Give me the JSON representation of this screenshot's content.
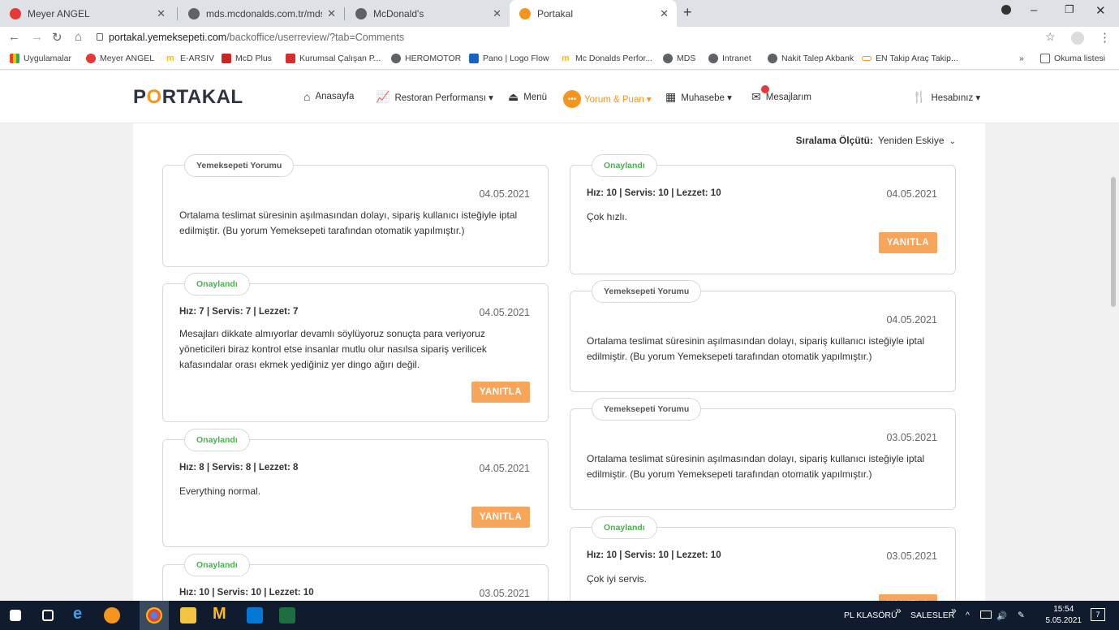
{
  "browser": {
    "tabs": [
      {
        "title": "Meyer ANGEL",
        "favicon": "meyer-icon",
        "active": false
      },
      {
        "title": "mds.mcdonalds.com.tr/mds/(S(c",
        "favicon": "globe-icon",
        "active": false
      },
      {
        "title": "McDonald's",
        "favicon": "globe-icon",
        "active": false
      },
      {
        "title": "Portakal",
        "favicon": "orange-icon",
        "active": true
      }
    ],
    "new_tab": "+",
    "url_host": "portakal.yemeksepeti.com",
    "url_path": "/backoffice/userreview/?tab=Comments",
    "bookmarks": [
      {
        "label": "Uygulamalar",
        "icon": "apps-icon"
      },
      {
        "label": "Meyer ANGEL",
        "icon": "meyer-icon"
      },
      {
        "label": "E-ARSIV",
        "icon": "mcdonalds-icon"
      },
      {
        "label": "McD Plus",
        "icon": "mcdonalds-icon"
      },
      {
        "label": "Kurumsal Çalışan P...",
        "icon": "u-icon"
      },
      {
        "label": "HEROMOTOR",
        "icon": "globe-icon"
      },
      {
        "label": "Pano | Logo Flow",
        "icon": "logo-icon"
      },
      {
        "label": "Mc Donalds Perfor...",
        "icon": "mcdonalds-icon"
      },
      {
        "label": "MDS",
        "icon": "globe-icon"
      },
      {
        "label": "Intranet",
        "icon": "globe-icon"
      },
      {
        "label": "Nakit Talep Akbank",
        "icon": "globe-icon"
      },
      {
        "label": "EN Takip Araç Takip...",
        "icon": "en-icon"
      }
    ],
    "bookmarks_more": "»",
    "reading_list": "Okuma listesi"
  },
  "site": {
    "logo": {
      "before": "P",
      "highlight": "O",
      "after": "RTAKAL"
    },
    "nav": [
      {
        "label": "Anasayfa",
        "icon": "home-icon"
      },
      {
        "label": "Restoran Performansı ▾",
        "icon": "chart-icon"
      },
      {
        "label": "Menü",
        "icon": "cloche-icon"
      },
      {
        "label": "Yorum & Puan ▾",
        "icon": "comment-icon"
      },
      {
        "label": "Muhasebe ▾",
        "icon": "grid-icon"
      },
      {
        "label": "Mesajlarım",
        "icon": "mail-icon"
      },
      {
        "label": "Hesabınız ▾",
        "icon": "fork-knife-icon"
      }
    ]
  },
  "sort": {
    "label": "Sıralama Ölçütü:",
    "value": "Yeniden Eskiye"
  },
  "reply_label": "YANITLA",
  "reviews_left": [
    {
      "status": "Yemeksepeti Yorumu",
      "scores": "",
      "date": "04.05.2021",
      "text": "Ortalama teslimat süresinin aşılmasından dolayı, sipariş kullanıcı isteğiyle iptal edilmiştir. (Bu yorum Yemeksepeti tarafından otomatik yapılmıştır.)"
    },
    {
      "status": "Onaylandı",
      "scores": "Hız: 7 | Servis: 7 | Lezzet: 7",
      "date": "04.05.2021",
      "text": "Mesajları dikkate almıyorlar devamlı söylüyoruz sonuçta para veriyoruz yöneticileri biraz kontrol etse insanlar mutlu olur nasılsa sipariş verilicek kafasındalar orası ekmek yediğiniz yer dingo ağırı değil."
    },
    {
      "status": "Onaylandı",
      "scores": "Hız: 8 | Servis: 8 | Lezzet: 8",
      "date": "04.05.2021",
      "text": "Everything normal."
    },
    {
      "status": "Onaylandı",
      "scores": "Hız: 10 | Servis: 10 | Lezzet: 10",
      "date": "03.05.2021",
      "text": ""
    }
  ],
  "reviews_right": [
    {
      "status": "Onaylandı",
      "scores": "Hız: 10 | Servis: 10 | Lezzet: 10",
      "date": "04.05.2021",
      "text": "Çok hızlı."
    },
    {
      "status": "Yemeksepeti Yorumu",
      "scores": "",
      "date": "04.05.2021",
      "text": "Ortalama teslimat süresinin aşılmasından dolayı, sipariş kullanıcı isteğiyle iptal edilmiştir. (Bu yorum Yemeksepeti tarafından otomatik yapılmıştır.)"
    },
    {
      "status": "Yemeksepeti Yorumu",
      "scores": "",
      "date": "03.05.2021",
      "text": "Ortalama teslimat süresinin aşılmasından dolayı, sipariş kullanıcı isteğiyle iptal edilmiştir. (Bu yorum Yemeksepeti tarafından otomatik yapılmıştır.)"
    },
    {
      "status": "Onaylandı",
      "scores": "Hız: 10 | Servis: 10 | Lezzet: 10",
      "date": "03.05.2021",
      "text": "Çok iyi servis."
    }
  ],
  "taskbar": {
    "toolbar1": "PL KLASÖRÜ",
    "toolbar2": "SALESLER",
    "chevron": "»",
    "time": "15:54",
    "date": "5.05.2021",
    "notification_count": "7"
  }
}
